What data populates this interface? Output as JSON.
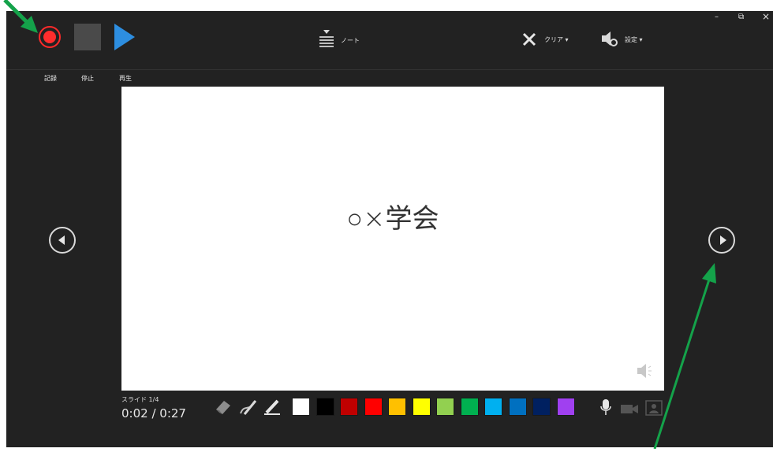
{
  "toolbar": {
    "record_label": "記録",
    "stop_label": "停止",
    "play_label": "再生",
    "notes_label": "ノート",
    "clear_label": "クリア ▾",
    "settings_label": "設定 ▾"
  },
  "window_controls": {
    "minimize": "–",
    "restore": "⧉",
    "close": "×"
  },
  "slide": {
    "title": "○×学会"
  },
  "status": {
    "slide_counter": "スライド 1/4",
    "time": "0:02 / 0:27"
  },
  "palette": [
    "#ffffff",
    "#000000",
    "#c00000",
    "#ff0000",
    "#ffc000",
    "#ffff00",
    "#92d050",
    "#00b050",
    "#00b0f0",
    "#0070c0",
    "#002060",
    "#a040f0"
  ],
  "icons": {
    "record": "record-icon",
    "stop": "stop-icon",
    "play": "play-icon",
    "notes": "notes-icon",
    "clear": "clear-icon",
    "settings": "speaker-gear-icon",
    "prev": "previous-slide-icon",
    "next": "next-slide-icon",
    "eraser": "eraser-icon",
    "pen": "pen-icon",
    "highlighter": "highlighter-icon",
    "mic": "microphone-icon",
    "camera": "camera-icon",
    "camera_preview": "camera-preview-icon",
    "audio": "audio-icon"
  },
  "annotation_color": "#14a24a"
}
